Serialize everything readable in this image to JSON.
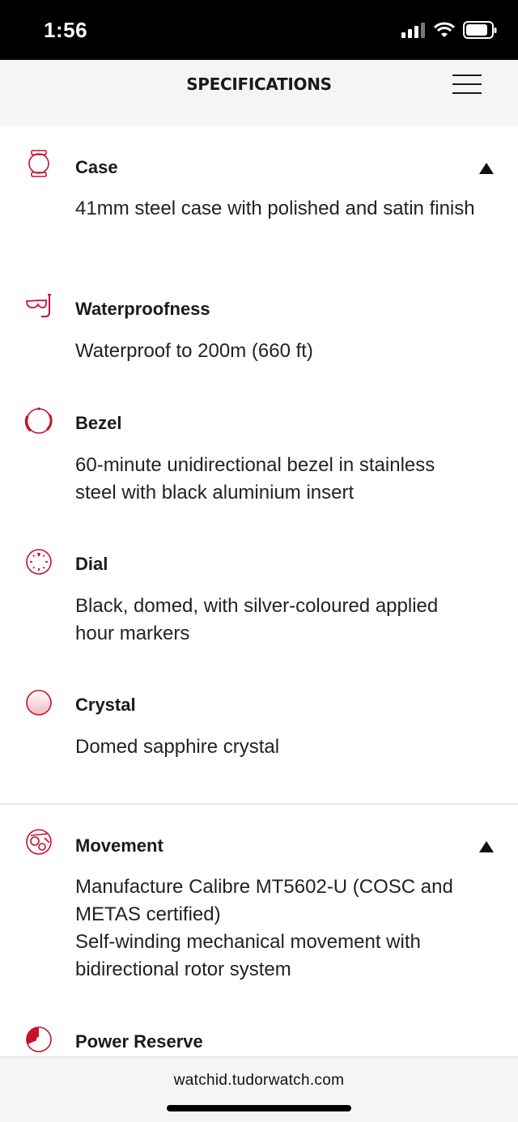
{
  "status_bar": {
    "time": "1:56"
  },
  "header": {
    "title": "SPECIFICATIONS"
  },
  "specs": [
    {
      "label": "Case",
      "description": "41mm steel case with polished and satin finish",
      "icon": "case-icon"
    },
    {
      "label": "Waterproofness",
      "description": "Waterproof to 200m (660 ft)",
      "icon": "snorkel-icon"
    },
    {
      "label": "Bezel",
      "description": "60-minute unidirectional bezel in stainless steel with black aluminium insert",
      "icon": "bezel-icon"
    },
    {
      "label": "Dial",
      "description": "Black, domed, with silver-coloured applied hour markers",
      "icon": "dial-icon"
    },
    {
      "label": "Crystal",
      "description": "Domed sapphire crystal",
      "icon": "crystal-icon"
    }
  ],
  "movement": {
    "label": "Movement",
    "description_line1": "Manufacture Calibre MT5602-U (COSC and METAS certified)",
    "description_line2": "Self-winding mechanical movement with bidirectional rotor system",
    "icon": "movement-icon"
  },
  "power_reserve": {
    "label": "Power Reserve",
    "icon": "power-reserve-icon"
  },
  "footer": {
    "url": "watchid.tudorwatch.com"
  },
  "colors": {
    "accent": "#c8102e",
    "header_bg": "#f5f5f5"
  }
}
